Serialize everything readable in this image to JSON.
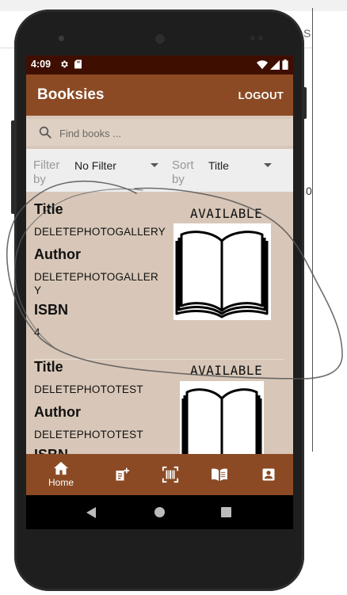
{
  "background": {
    "right_edge_text": "S",
    "right_edge_text2": "0"
  },
  "status_bar": {
    "time": "4:09",
    "left_icons": [
      "gear-icon",
      "sd-card-icon"
    ],
    "right_icons": [
      "wifi-icon",
      "signal-icon",
      "battery-icon"
    ]
  },
  "app_bar": {
    "title": "Booksies",
    "logout_label": "LOGOUT"
  },
  "search": {
    "placeholder": "Find books ..."
  },
  "filter": {
    "filter_label": "Filter by",
    "filter_value": "No Filter",
    "sort_label": "Sort by",
    "sort_value": "Title"
  },
  "books": [
    {
      "title_label": "Title",
      "title": "DELETEPHOTOGALLERY",
      "author_label": "Author",
      "author": "DELETEPHOTOGALLERY",
      "isbn_label": "ISBN",
      "isbn": "4",
      "status": "AVAILABLE",
      "image": "open-book-icon"
    },
    {
      "title_label": "Title",
      "title": "DELETEPHOTOTEST",
      "author_label": "Author",
      "author": "DELETEPHOTOTEST",
      "isbn_label": "ISBN",
      "status": "AVAILABLE",
      "image": "open-book-icon"
    }
  ],
  "bottom_nav": [
    {
      "label": "Home",
      "icon": "home-icon",
      "active": true
    },
    {
      "label": "",
      "icon": "add-note-icon"
    },
    {
      "label": "",
      "icon": "barcode-scan-icon"
    },
    {
      "label": "",
      "icon": "book-icon"
    },
    {
      "label": "",
      "icon": "profile-icon"
    }
  ],
  "colors": {
    "primary": "#8b4a24",
    "status_bar": "#3e0f00",
    "background": "#d8c7b8",
    "filter_bar": "#eeeeee"
  }
}
